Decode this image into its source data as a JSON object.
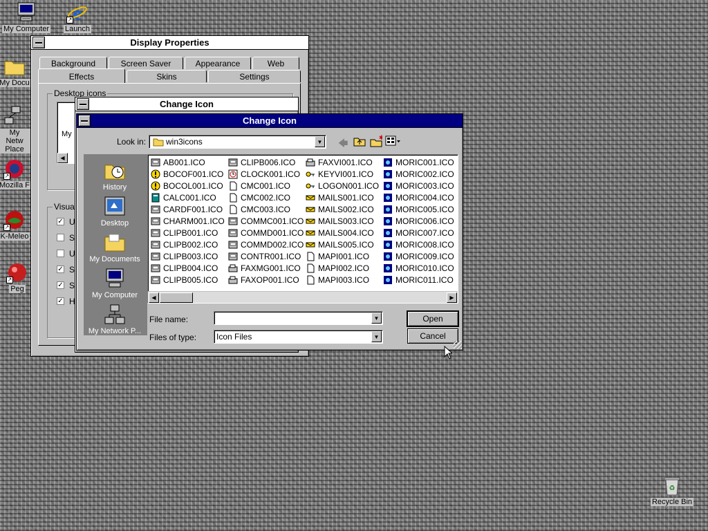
{
  "desktop": {
    "icons": [
      {
        "label": "My Computer"
      },
      {
        "label": "Launch"
      },
      {
        "label": "My Docu"
      },
      {
        "label": "My Netw Place"
      },
      {
        "label": "Mozilla F"
      },
      {
        "label": "K-Meleo"
      },
      {
        "label": "Peg"
      },
      {
        "label": "Recycle Bin"
      }
    ]
  },
  "display_properties": {
    "title": "Display Properties",
    "tabs_row1": [
      "Background",
      "Screen Saver",
      "Appearance",
      "Web"
    ],
    "tabs_row2": [
      "Effects",
      "Skins",
      "Settings"
    ],
    "group_desktop_icons": "Desktop icons",
    "my_partial": "My",
    "group_visual": "Visual",
    "visual_checks": [
      {
        "label": "U",
        "checked": true
      },
      {
        "label": "S",
        "checked": false
      },
      {
        "label": "U",
        "checked": false
      },
      {
        "label": "S",
        "checked": true
      },
      {
        "label": "S",
        "checked": true
      },
      {
        "label": "H",
        "checked": true
      }
    ],
    "check_mark": "✓"
  },
  "change_icon_back": {
    "title": "Change Icon"
  },
  "change_icon_dialog": {
    "title": "Change Icon",
    "look_in_label": "Look in:",
    "look_in_value": "win3icons",
    "places": [
      "History",
      "Desktop",
      "My Documents",
      "My Computer",
      "My Network P..."
    ],
    "files": [
      [
        "AB001.ICO",
        "BOCOF001.ICO",
        "BOCOL001.ICO",
        "CALC001.ICO",
        "CARDF001.ICO",
        "CHARM001.ICO",
        "CLIPB001.ICO",
        "CLIPB002.ICO",
        "CLIPB003.ICO",
        "CLIPB004.ICO",
        "CLIPB005.ICO"
      ],
      [
        "CLIPB006.ICO",
        "CLOCK001.ICO",
        "CMC001.ICO",
        "CMC002.ICO",
        "CMC003.ICO",
        "COMMC001.ICO",
        "COMMD001.ICO",
        "COMMD002.ICO",
        "CONTR001.ICO",
        "FAXMG001.ICO",
        "FAXOP001.ICO"
      ],
      [
        "FAXVI001.ICO",
        "KEYVI001.ICO",
        "LOGON001.ICO",
        "MAILS001.ICO",
        "MAILS002.ICO",
        "MAILS003.ICO",
        "MAILS004.ICO",
        "MAILS005.ICO",
        "MAPI001.ICO",
        "MAPI002.ICO",
        "MAPI003.ICO"
      ],
      [
        "MORIC001.ICO",
        "MORIC002.ICO",
        "MORIC003.ICO",
        "MORIC004.ICO",
        "MORIC005.ICO",
        "MORIC006.ICO",
        "MORIC007.ICO",
        "MORIC008.ICO",
        "MORIC009.ICO",
        "MORIC010.ICO",
        "MORIC011.ICO"
      ]
    ],
    "file_name_label": "File name:",
    "file_name_value": "",
    "files_of_type_label": "Files of type:",
    "files_of_type_value": "Icon Files",
    "open_label": "Open",
    "cancel_label": "Cancel"
  },
  "colors": {
    "active_title": "#000080",
    "window_face": "#c0c0c0",
    "places_bar": "#808080"
  }
}
